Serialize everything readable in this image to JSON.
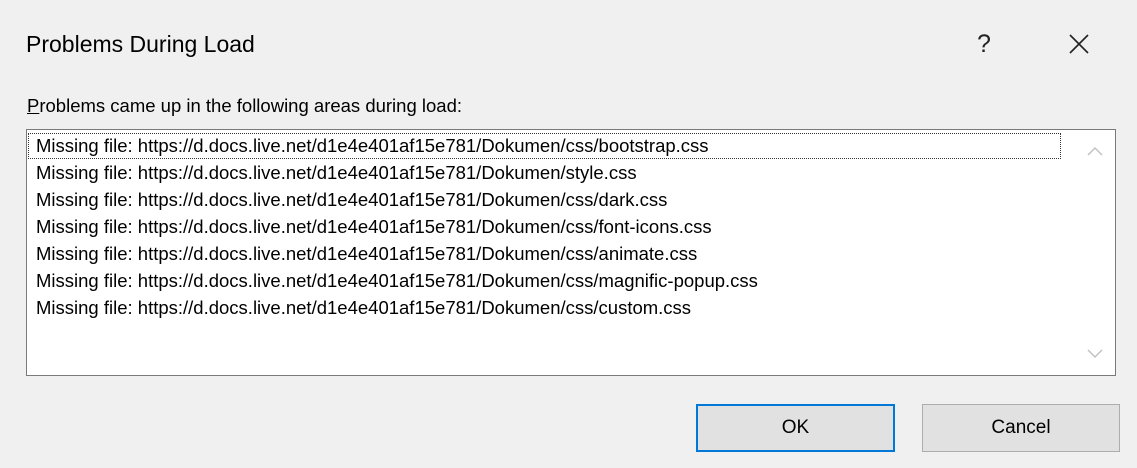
{
  "dialog": {
    "title": "Problems During Load",
    "help_label": "?",
    "instruction": "Problems came up in the following areas during load:"
  },
  "problems": [
    "Missing file: https://d.docs.live.net/d1e4e401af15e781/Dokumen/css/bootstrap.css",
    "Missing file: https://d.docs.live.net/d1e4e401af15e781/Dokumen/style.css",
    "Missing file: https://d.docs.live.net/d1e4e401af15e781/Dokumen/css/dark.css",
    "Missing file: https://d.docs.live.net/d1e4e401af15e781/Dokumen/css/font-icons.css",
    "Missing file: https://d.docs.live.net/d1e4e401af15e781/Dokumen/css/animate.css",
    "Missing file: https://d.docs.live.net/d1e4e401af15e781/Dokumen/css/magnific-popup.css",
    "Missing file: https://d.docs.live.net/d1e4e401af15e781/Dokumen/css/custom.css"
  ],
  "buttons": {
    "ok_label": "OK",
    "cancel_label": "Cancel"
  },
  "icons": {
    "help": "help-icon",
    "close": "close-icon",
    "scroll_up": "chevron-up-icon",
    "scroll_down": "chevron-down-icon"
  },
  "colors": {
    "dialog_bg": "#f0f0f0",
    "default_button_border": "#0078d7",
    "button_bg": "#e1e1e1"
  }
}
